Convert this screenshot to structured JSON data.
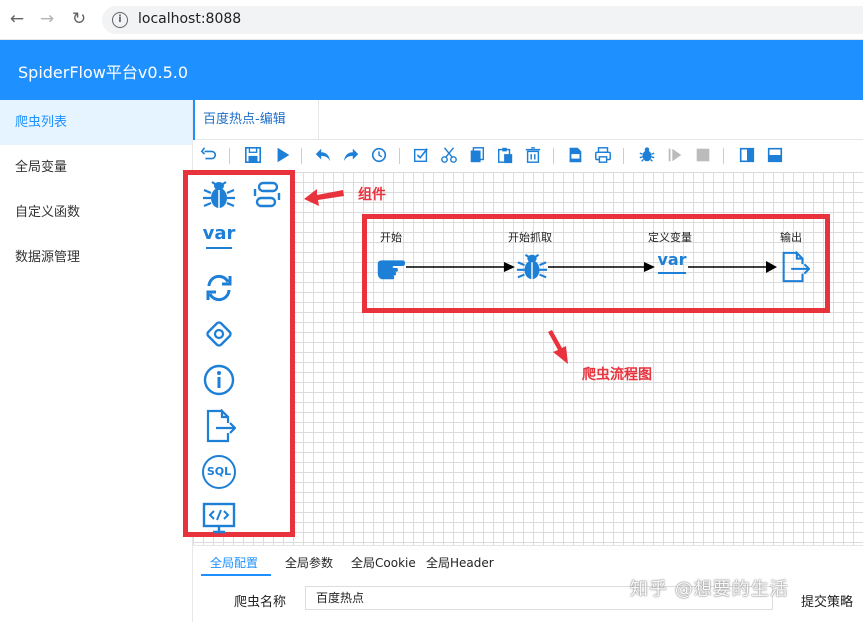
{
  "browser": {
    "url": "localhost:8088"
  },
  "app": {
    "title": "SpiderFlow平台v0.5.0"
  },
  "sidebar": {
    "items": [
      {
        "label": "爬虫列表"
      },
      {
        "label": "全局变量"
      },
      {
        "label": "自定义函数"
      },
      {
        "label": "数据源管理"
      }
    ]
  },
  "tabs": [
    {
      "label": "百度热点-编辑"
    }
  ],
  "palette": {
    "var_label": "var",
    "sql_label": "SQL"
  },
  "flow": {
    "nodes": [
      {
        "label": "开始",
        "icon": "hand-pointer-icon"
      },
      {
        "label": "开始抓取",
        "icon": "spider-icon"
      },
      {
        "label": "定义变量",
        "icon": "var-icon",
        "text": "var"
      },
      {
        "label": "输出",
        "icon": "output-icon"
      }
    ]
  },
  "annotations": {
    "components": "组件",
    "flowchart": "爬虫流程图"
  },
  "bottom": {
    "tabs": [
      {
        "label": "全局配置"
      },
      {
        "label": "全局参数"
      },
      {
        "label": "全局Cookie"
      },
      {
        "label": "全局Header"
      }
    ],
    "name_label": "爬虫名称",
    "name_value": "百度热点",
    "strategy_label": "提交策略"
  },
  "watermark": "知乎 @想要的生活",
  "colors": {
    "brand": "#1e90ff",
    "annotation": "#e8333d",
    "icon": "#1e7fd6"
  }
}
